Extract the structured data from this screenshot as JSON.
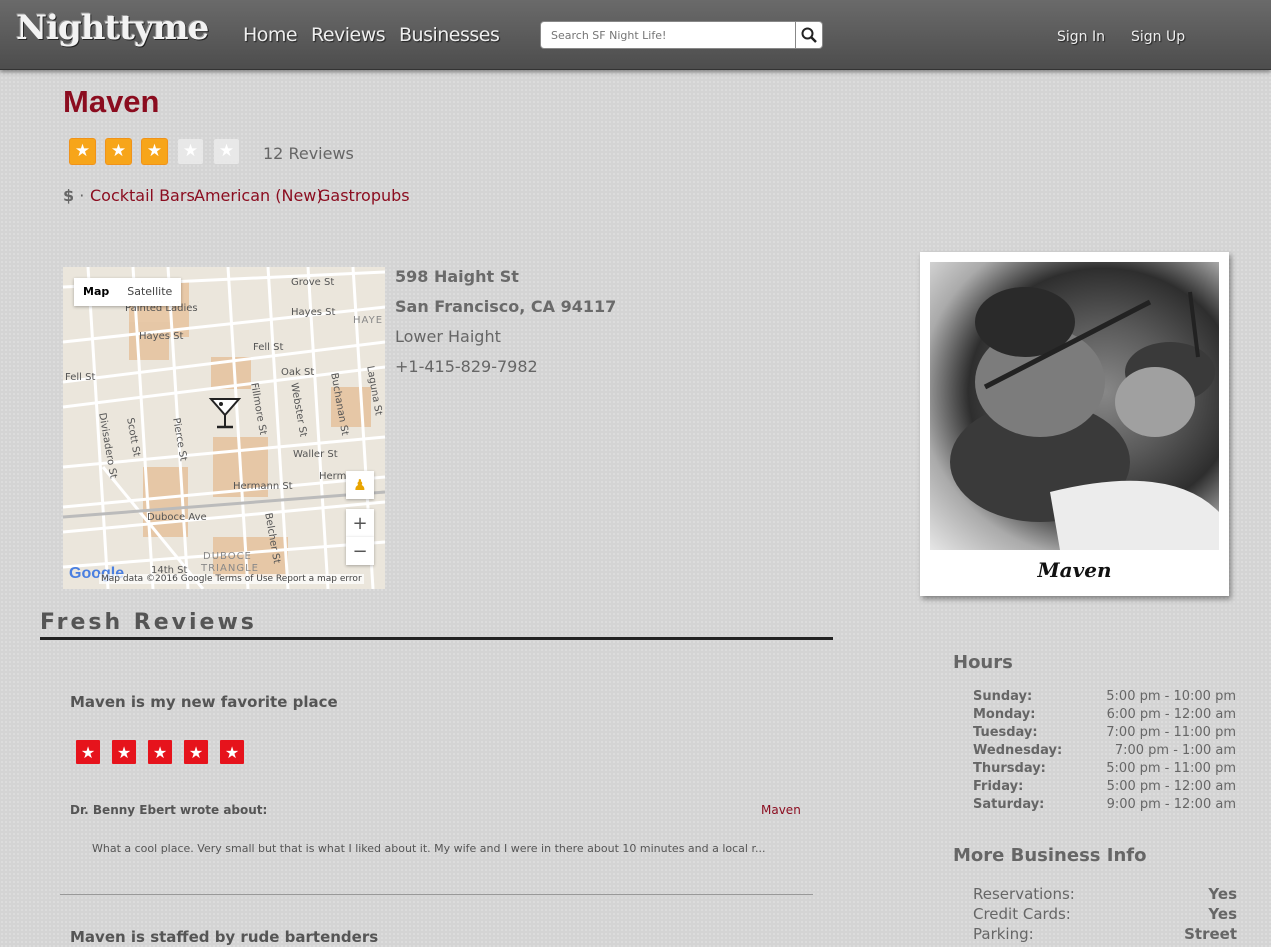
{
  "header": {
    "logo": "Nighttyme",
    "nav": [
      "Home",
      "Reviews",
      "Businesses"
    ],
    "search_placeholder": "Search SF Night Life!",
    "sign_in": "Sign In",
    "sign_up": "Sign Up"
  },
  "business": {
    "name": "Maven",
    "rating": 3,
    "rating_max": 5,
    "review_count": "12 Reviews",
    "price": "$",
    "categories": [
      "Cocktail Bars",
      "American (New)",
      "Gastropubs"
    ],
    "address_line1": "598 Haight St",
    "address_line2": "San Francisco, CA 94117",
    "neighborhood": "Lower Haight",
    "phone": "+1-415-829-7982",
    "photo_caption": "Maven"
  },
  "map": {
    "tab_map": "Map",
    "tab_satellite": "Satellite",
    "footer": "Map data ©2016 Google   Terms of Use   Report a map error",
    "google": "Google",
    "streets": [
      "Grove St",
      "Painted Ladies",
      "Hayes St",
      "HAYE",
      "Hayes St",
      "Fell St",
      "Oak St",
      "Fell St",
      "Scott St",
      "Pierce St",
      "Fillmore St",
      "Webster St",
      "Buchanan St",
      "Laguna St",
      "Divisadero St",
      "Waller St",
      "Hermann St",
      "Herma",
      "Duboce Ave",
      "Belcher St",
      "DUBOCE",
      "TRIANGLE",
      "14th St"
    ]
  },
  "reviews": {
    "section_title": "Fresh Reviews",
    "items": [
      {
        "title": "Maven is my new favorite place",
        "stars": 5,
        "author": "Dr. Benny Ebert wrote about:",
        "business": "Maven",
        "body": "What a cool place. Very small but that is what I liked about it. My wife and I were in there about 10 minutes and a local r..."
      },
      {
        "title": "Maven is staffed by rude bartenders"
      }
    ]
  },
  "hours": {
    "title": "Hours",
    "rows": [
      {
        "day": "Sunday:",
        "time": "5:00 pm - 10:00 pm"
      },
      {
        "day": "Monday:",
        "time": "6:00 pm - 12:00 am"
      },
      {
        "day": "Tuesday:",
        "time": "7:00 pm - 11:00 pm"
      },
      {
        "day": "Wednesday:",
        "time": "7:00 pm - 1:00 am"
      },
      {
        "day": "Thursday:",
        "time": "5:00 pm - 11:00 pm"
      },
      {
        "day": "Friday:",
        "time": "5:00 pm - 12:00 am"
      },
      {
        "day": "Saturday:",
        "time": "9:00 pm - 12:00 am"
      }
    ]
  },
  "more_info": {
    "title": "More Business Info",
    "rows": [
      {
        "key": "Reservations:",
        "value": "Yes"
      },
      {
        "key": "Credit Cards:",
        "value": "Yes"
      },
      {
        "key": "Parking:",
        "value": "Street"
      }
    ]
  },
  "colors": {
    "brand_red": "#8b0c1f",
    "star_orange": "#f7a51a",
    "review_star_red": "#e6131c"
  }
}
